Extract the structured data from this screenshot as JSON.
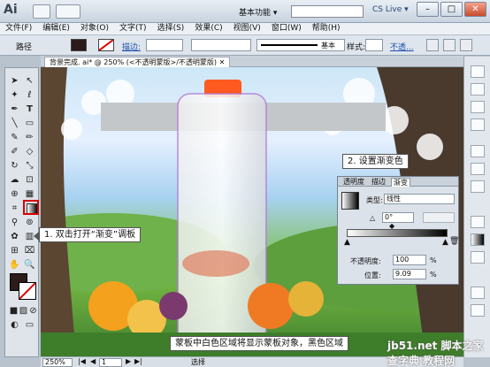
{
  "titlebar": {
    "app_icon": "Ai",
    "workspace": "基本功能 ▾",
    "cs_live": "CS Live ▾",
    "search_placeholder": "",
    "buttons": {
      "min": "–",
      "max": "□",
      "close": "✕"
    }
  },
  "menu": [
    "文件(F)",
    "编辑(E)",
    "对象(O)",
    "文字(T)",
    "选择(S)",
    "效果(C)",
    "视图(V)",
    "窗口(W)",
    "帮助(H)"
  ],
  "control": {
    "path_label": "路径",
    "stroke_label": "描边:",
    "stroke_value": "",
    "brush_value": "基本",
    "style_label": "样式:",
    "opacity_label": "不透..."
  },
  "document": {
    "tab": "背景完成. ai* @ 250% (<不透明蒙版>/不透明蒙版)"
  },
  "status": {
    "zoom": "250%",
    "page": "1",
    "mode": "选择"
  },
  "gradient": {
    "tabs": [
      "透明度",
      "描边",
      "渐变"
    ],
    "type_label": "类型:",
    "type_value": "线性",
    "angle_value": "0°",
    "opacity_label": "不透明度:",
    "opacity_value": "100",
    "opacity_unit": "%",
    "position_label": "位置:",
    "position_value": "9.09",
    "position_unit": "%"
  },
  "callouts": {
    "step1": "1. 双击打开“渐变”调板",
    "step2": "2. 设置渐变色",
    "caption": "蒙板中白色区域将显示蒙板对象，黑色区域"
  },
  "watermark": "jb51.net 脚本之家 查字典 教程网",
  "colors": {
    "accent": "#d80000",
    "brand": "#284a78"
  }
}
